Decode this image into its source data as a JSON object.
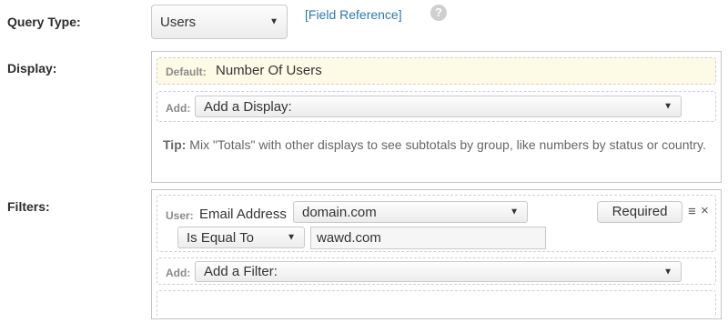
{
  "query_type": {
    "label": "Query Type:",
    "selected": "Users",
    "field_reference": "[Field Reference]",
    "help_icon": "?"
  },
  "display": {
    "label": "Display:",
    "default_prefix": "Default:",
    "default_value": "Number Of Users",
    "add_prefix": "Add:",
    "add_select": "Add a Display:",
    "tip_prefix": "Tip:",
    "tip_text": " Mix \"Totals\" with other displays to see subtotals by group, like numbers by status or country."
  },
  "filters": {
    "label": "Filters:",
    "filter_prefix": "User:",
    "field_name": "Email Address",
    "field_select": "domain.com",
    "required_button": "Required",
    "menu_glyph": "≡",
    "close_glyph": "×",
    "operator_select": "Is Equal To",
    "value_input": "wawd.com",
    "add_prefix": "Add:",
    "add_select": "Add a Filter:"
  },
  "colors": {
    "default_highlight": "#fdfbe6",
    "link": "#2a7ab0"
  }
}
